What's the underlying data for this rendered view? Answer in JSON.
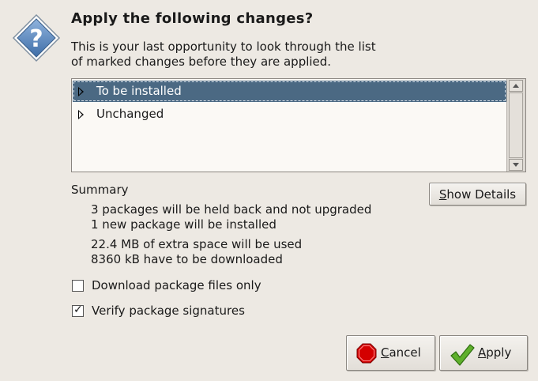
{
  "dialog": {
    "title": "Apply the following changes?",
    "description": "This is your last opportunity to look through the list\nof marked changes before they are applied.",
    "icon": "question-icon"
  },
  "changes_list": {
    "rows": [
      {
        "label": "To be installed",
        "selected": true,
        "expander": "collapsed"
      },
      {
        "label": "Unchanged",
        "selected": false,
        "expander": "collapsed"
      }
    ]
  },
  "summary": {
    "title": "Summary",
    "lines": [
      "3 packages will be held back and not upgraded",
      "1 new package will be installed",
      "22.4 MB of extra space will be used",
      "8360 kB have to be downloaded"
    ],
    "show_details_mnemonic": "S",
    "show_details_rest": "how Details"
  },
  "options": [
    {
      "label": "Download package files only",
      "checked": false
    },
    {
      "label": "Verify package signatures",
      "checked": true
    }
  ],
  "buttons": {
    "cancel_mnemonic": "C",
    "cancel_rest": "ancel",
    "apply_mnemonic": "A",
    "apply_rest": "pply"
  },
  "colors": {
    "background": "#ede9e3",
    "selection": "#4b6983",
    "cancel_icon": "#d40000",
    "apply_icon": "#5fb02c"
  }
}
